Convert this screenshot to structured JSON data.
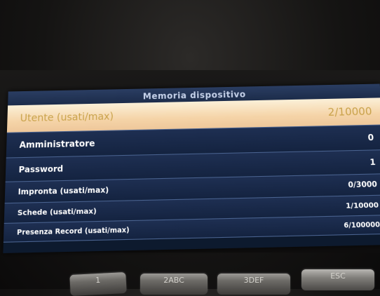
{
  "screen": {
    "title": "Memoria dispositivo",
    "rows": [
      {
        "label": "Utente (usati/max)",
        "value": "2/10000",
        "selected": true
      },
      {
        "label": "Amministratore",
        "value": "0",
        "selected": false
      },
      {
        "label": "Password",
        "value": "1",
        "selected": false
      },
      {
        "label": "Impronta (usati/max)",
        "value": "0/3000",
        "selected": false
      },
      {
        "label": "Schede (usati/max)",
        "value": "1/10000",
        "selected": false
      },
      {
        "label": "Presenza Record (usati/max)",
        "value": "6/100000",
        "selected": false
      }
    ]
  },
  "keypad": {
    "key1": "1",
    "key2": "2ABC",
    "key3": "3DEF",
    "esc": "ESC"
  },
  "colors": {
    "selected_row_bg": "#f5d4a8",
    "row_bg": "#1e2f52",
    "divider": "#4a6390"
  }
}
